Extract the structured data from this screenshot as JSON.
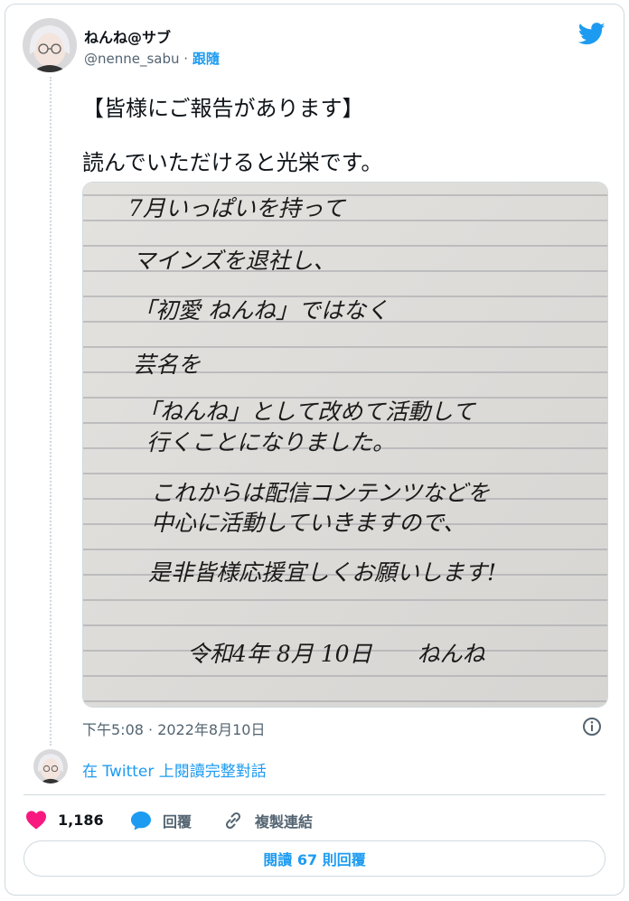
{
  "user": {
    "display_name": "ねんね@サブ",
    "handle": "@nenne_sabu",
    "separator": "·",
    "follow_label": "跟隨"
  },
  "tweet": {
    "line1": "【皆様にご報告があります】",
    "line2": "読んでいただけると光栄です。",
    "timestamp": "下午5:08 · 2022年8月10日"
  },
  "photo": {
    "lines": [
      "7月いっぱいを持って",
      "マインズを退社し、",
      "「初愛 ねんね」ではなく",
      "芸名を",
      "「ねんね」として改めて活動して",
      "行くことになりました。",
      "これからは配信コンテンツなどを",
      "中心に活動していきますので、",
      "是非皆様応援宜しくお願いします!",
      "令和4年 8月 10日　　ねんね"
    ]
  },
  "thread_link": "在 Twitter 上閱讀完整對話",
  "actions": {
    "like_count": "1,186",
    "reply_label": "回覆",
    "copy_link_label": "複製連結"
  },
  "read_replies_label": "閱讀 67 則回覆",
  "colors": {
    "accent": "#1d9bf0",
    "like": "#f91880",
    "secondary_text": "#536471",
    "border": "#cfd9de"
  }
}
